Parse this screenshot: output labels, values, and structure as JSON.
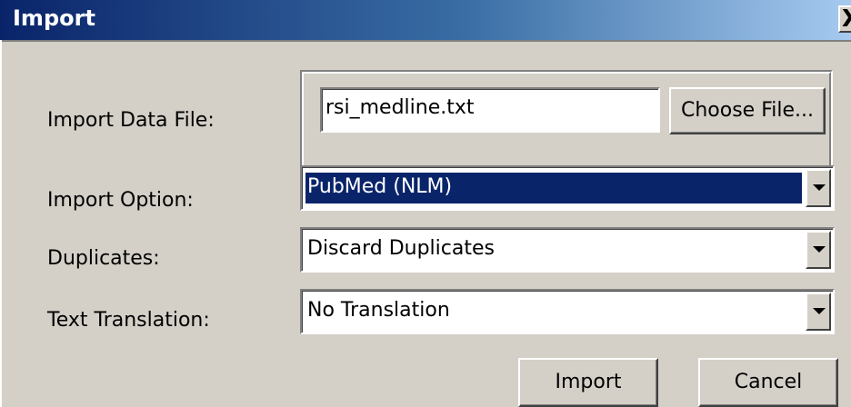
{
  "window": {
    "title": "Import",
    "close_label": "X"
  },
  "form": {
    "import_data_file_label": "Import Data File:",
    "file_value": "rsi_medline.txt",
    "choose_file_label": "Choose File...",
    "import_option_label": "Import Option:",
    "import_option_value": "PubMed (NLM)",
    "duplicates_label": "Duplicates:",
    "duplicates_value": "Discard Duplicates",
    "text_translation_label": "Text Translation:",
    "text_translation_value": "No Translation"
  },
  "actions": {
    "import_label": "Import",
    "cancel_label": "Cancel"
  },
  "colors": {
    "selection": "#0a246a",
    "dialog_bg": "#d4d0c8"
  }
}
